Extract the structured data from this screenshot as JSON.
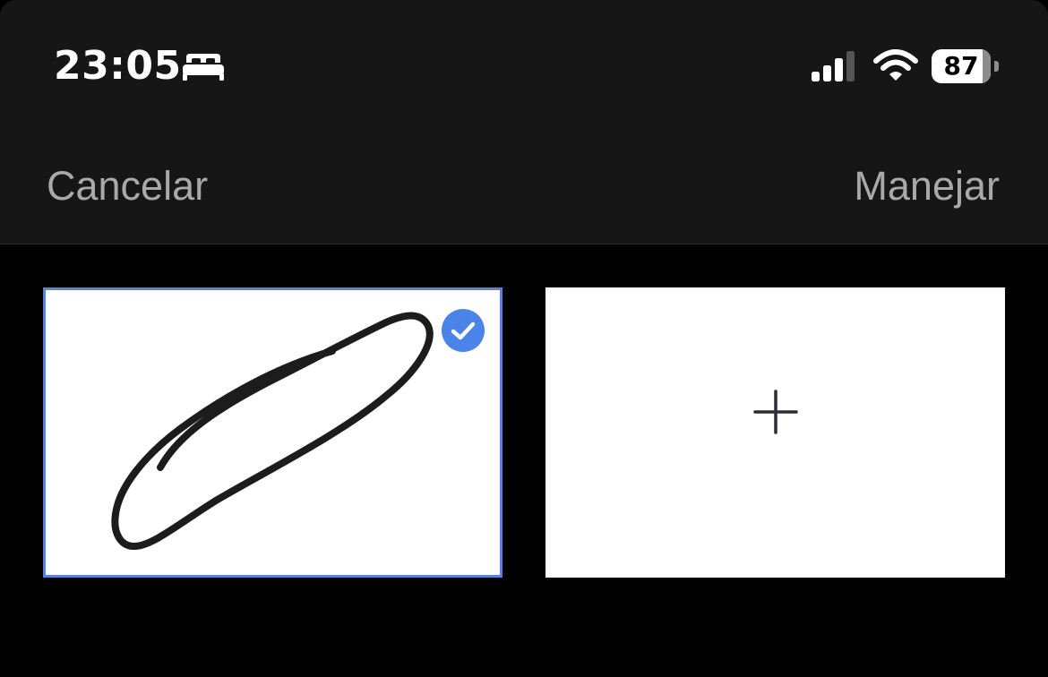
{
  "status_bar": {
    "time": "23:05",
    "focus_icon": "bed-icon",
    "signal_icon": "cellular-signal-icon",
    "wifi_icon": "wifi-icon",
    "battery_percent": "87",
    "battery_level": 0.87
  },
  "nav": {
    "cancel_label": "Cancelar",
    "manage_label": "Manejar"
  },
  "signatures": {
    "selected_card": {
      "selected": true,
      "check_icon": "checkmark-circle-icon"
    },
    "add_card": {
      "icon": "plus-icon"
    }
  },
  "colors": {
    "topbar_bg": "#161616",
    "background": "#000000",
    "nav_text": "#a9a9a9",
    "accent": "#4a84e8",
    "selection_border": "#5b82d6",
    "ink": "#1c1c1e"
  }
}
